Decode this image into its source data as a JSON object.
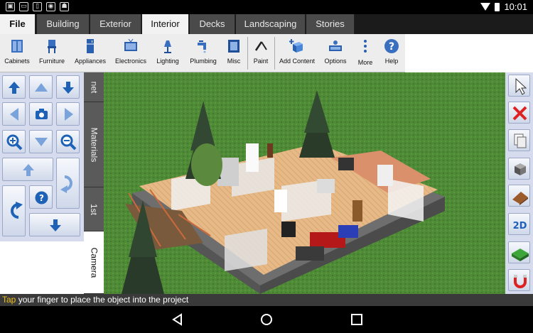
{
  "status_bar": {
    "time": "10:01"
  },
  "tabs": [
    {
      "label": "File"
    },
    {
      "label": "Building"
    },
    {
      "label": "Exterior"
    },
    {
      "label": "Interior"
    },
    {
      "label": "Decks"
    },
    {
      "label": "Landscaping"
    },
    {
      "label": "Stories"
    }
  ],
  "active_tab": "Interior",
  "ribbon": {
    "cabinets": "Cabinets",
    "furniture": "Furniture",
    "appliances": "Appliances",
    "electronics": "Electronics",
    "lighting": "Lighting",
    "plumbing": "Plumbing",
    "misc": "Misc",
    "paint": "Paint",
    "add_content": "Add Content",
    "options": "Options",
    "more": "More",
    "help": "Help"
  },
  "vertical_tabs": {
    "cabinet_partial": "net",
    "materials": "Materials",
    "first": "1st",
    "camera": "Camera"
  },
  "hint": {
    "highlight": "Tap",
    "rest": " your finger to place the object into the project"
  },
  "colors": {
    "grass": "#4f8a36",
    "accent": "#1e62b8",
    "tab_dark": "#4a4a4a"
  }
}
